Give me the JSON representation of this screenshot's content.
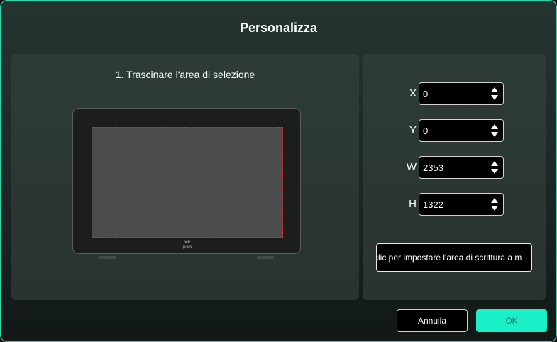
{
  "dialog": {
    "title": "Personalizza"
  },
  "left_panel": {
    "instruction": "1. Trascinare l'area di selezione",
    "tablet_logo_line1": "XP",
    "tablet_logo_line2": "pen"
  },
  "fields": [
    {
      "label": "X",
      "value": "0"
    },
    {
      "label": "Y",
      "value": "0"
    },
    {
      "label": "W",
      "value": "2353"
    },
    {
      "label": "H",
      "value": "1322"
    }
  ],
  "set_area_button": {
    "label": "clic per impostare l'area di scrittura a m"
  },
  "footer": {
    "cancel_label": "Annulla",
    "ok_label": "OK"
  },
  "colors": {
    "accent": "#19f0c8",
    "selection_border": "#e0282e",
    "dialog_border": "#2fd6b0"
  },
  "icons": {
    "spin_up": "triangle-up",
    "spin_down": "triangle-down"
  }
}
